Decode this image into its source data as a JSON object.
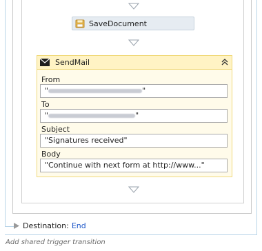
{
  "workflow": {
    "save_activity": {
      "label": "SaveDocument",
      "icon": "save-document-icon"
    },
    "sendmail": {
      "title": "SendMail",
      "fields": [
        {
          "label": "From",
          "value_prefix": "\"",
          "value_suffix": "\""
        },
        {
          "label": "To",
          "value_prefix": "\"",
          "value_suffix": "\""
        },
        {
          "label": "Subject",
          "value": "\"Signatures received\""
        },
        {
          "label": "Body",
          "value": "\"Continue with next form at http://www...\""
        }
      ]
    },
    "destination": {
      "label": "Destination:",
      "value": "End"
    },
    "add_transition": "Add shared trigger transition"
  },
  "colors": {
    "accent_link": "#1a55c8",
    "sendmail_header": "#fff3c4",
    "sendmail_body": "#fffbea",
    "activity_bg": "#e6ecf2"
  }
}
